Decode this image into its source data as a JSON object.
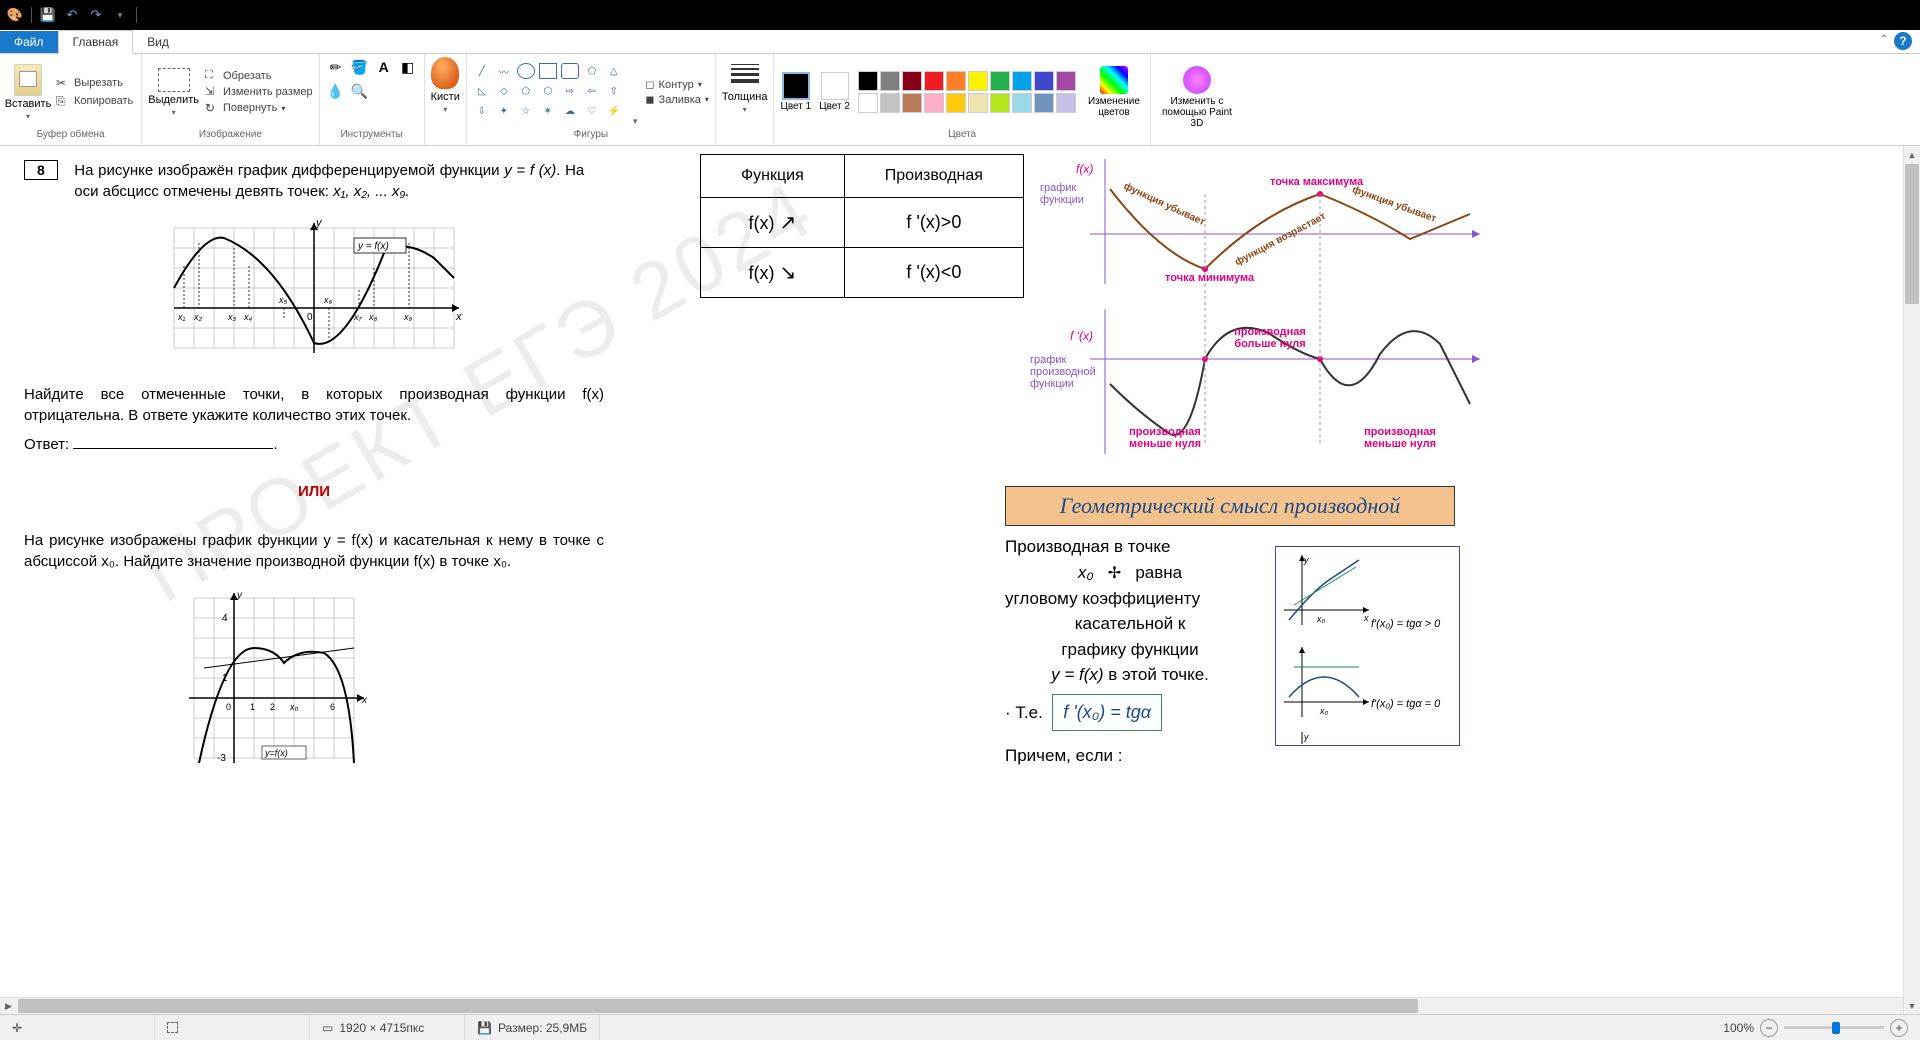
{
  "titlebar": {
    "icons": [
      "paint",
      "save",
      "undo",
      "redo"
    ]
  },
  "tabs": {
    "file": "Файл",
    "home": "Главная",
    "view": "Вид"
  },
  "ribbon": {
    "clipboard": {
      "paste": "Вставить",
      "cut": "Вырезать",
      "copy": "Копировать",
      "group": "Буфер обмена"
    },
    "image": {
      "select": "Выделить",
      "crop": "Обрезать",
      "resize": "Изменить размер",
      "rotate": "Повернуть",
      "group": "Изображение"
    },
    "tools": {
      "group": "Инструменты"
    },
    "brushes": {
      "label": "Кисти"
    },
    "shapes": {
      "outline": "Контур",
      "fill": "Заливка",
      "group": "Фигуры"
    },
    "size": {
      "label": "Толщина"
    },
    "colors": {
      "color1": "Цвет 1",
      "color2": "Цвет 2",
      "edit": "Изменение цветов",
      "group": "Цвета"
    },
    "paint3d": {
      "label": "Изменить с помощью Paint 3D"
    }
  },
  "palette": {
    "row1": [
      "#000000",
      "#7f7f7f",
      "#880015",
      "#ed1c24",
      "#ff7f27",
      "#fff200",
      "#22b14c",
      "#00a2e8",
      "#3f48cc",
      "#a349a4"
    ],
    "row2": [
      "#ffffff",
      "#c3c3c3",
      "#b97a57",
      "#ffaec9",
      "#ffc90e",
      "#efe4b0",
      "#b5e61d",
      "#99d9ea",
      "#7092be",
      "#c8bfe7"
    ]
  },
  "problem": {
    "num": "8",
    "text1_a": "На рисунке изображён график дифференцируемой функции ",
    "text1_fn": "y = f (x)",
    "text1_b": ". На оси абсцисс отмечены девять точек: ",
    "text1_pts": "x₁, x₂, ... x₉.",
    "graph_label": "y = f(x)",
    "axis_pts": [
      "x₁",
      "x₂",
      "x₃",
      "x₄",
      "x₅",
      "x₆",
      "x₇",
      "x₈",
      "x₉"
    ],
    "text2": "Найдите все отмеченные точки, в которых производная функции f(x) отрицательна. В ответе укажите количество этих точек.",
    "answer": "Ответ:",
    "or": "ИЛИ",
    "text3": "На рисунке изображены график функции y = f(x) и касательная к нему в точке с абсциссой x₀. Найдите значение производной функции f(x) в точке x₀.",
    "graph2_yticks": [
      "4",
      "1",
      "-3"
    ],
    "graph2_xticks": [
      "0",
      "1",
      "2",
      "x₀",
      "6"
    ],
    "graph2_label": "y=f(x)"
  },
  "watermark": "ПРОЕКТ ЕГЭ 2024",
  "deriv_table": {
    "h1": "Функция",
    "h2": "Производная",
    "r1c1": "f(x) ↗",
    "r1c2": "f '(x)>0",
    "r2c1": "f(x) ↘",
    "r2c2": "f '(x)<0"
  },
  "diagram": {
    "fx": "f(x)",
    "fpx": "f '(x)",
    "g1": "график функции",
    "g2": "график производной функции",
    "t_max": "точка максимума",
    "t_min": "точка минимума",
    "f_dec": "функция убывает",
    "f_inc": "функция возрастает",
    "d_gt": "производная больше нуля",
    "d_lt": "производная меньше нуля"
  },
  "geom": {
    "title": "Геометрический смысл производной",
    "line1": "Производная в точке",
    "x0": "x₀",
    "line2": "равна",
    "line3": "угловому коэффициенту",
    "line4": "касательной к",
    "line5": "графику функции",
    "line6": "y = f(x) в этой точке.",
    "ie": "Т.е.",
    "formula": "f '(x₀) = tgα",
    "also": "Причем, если :",
    "diag1": "f'(x₀) = tgα > 0",
    "diag2": "f'(x₀) = tgα = 0"
  },
  "statusbar": {
    "dims": "1920 × 4715пкс",
    "size": "Размер: 25,9МБ",
    "zoom": "100%"
  }
}
